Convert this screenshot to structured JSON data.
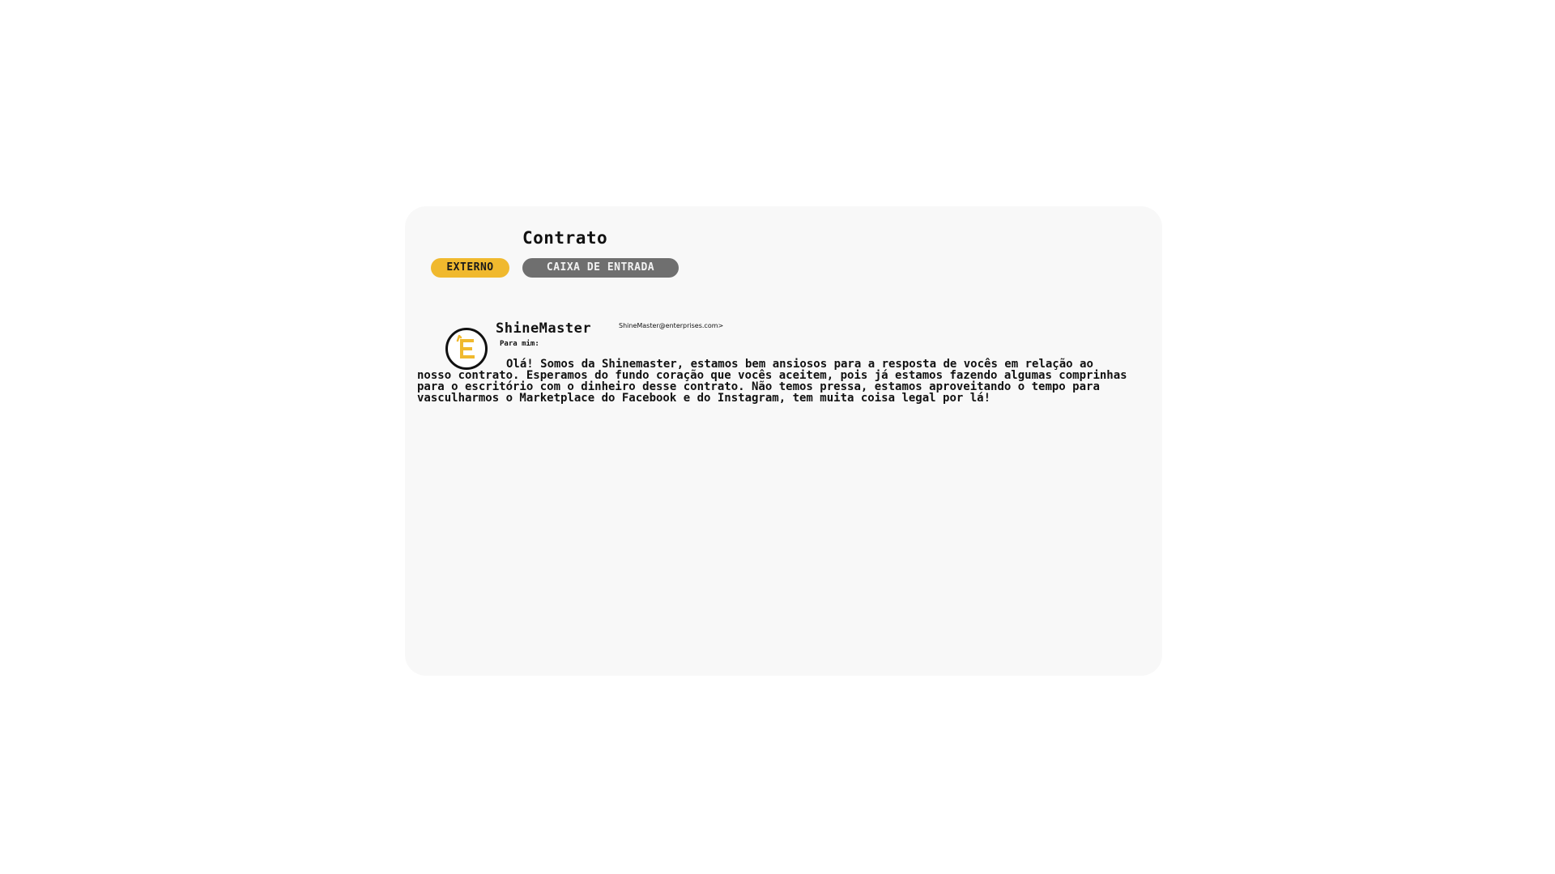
{
  "email": {
    "subject": "Contrato",
    "tags": {
      "externo": "EXTERNO",
      "caixa_de_entrada": "CAIXA DE ENTRADA"
    },
    "sender": {
      "name": "ShineMaster",
      "email": "ShineMaster@enterprises.com>",
      "avatar_icon": "enterprise-e-logo-icon"
    },
    "recipient": "Para mim:",
    "body": "Olá! Somos da Shinemaster, estamos bem ansiosos para a resposta de vocês em relação ao nosso contrato. Esperamos do fundo coração que vocês aceitem, pois já estamos fazendo algumas comprinhas para o escritório com o dinheiro desse contrato. Não temos pressa, estamos aproveitando o tempo para vasculharmos o Marketplace do Facebook e do Instagram, tem muita coisa legal por lá!"
  },
  "colors": {
    "card_background": "#f8f8f8",
    "tag_externo": "#f0b92e",
    "tag_caixa": "#6f6f6f",
    "logo_accent": "#f0b92e"
  }
}
